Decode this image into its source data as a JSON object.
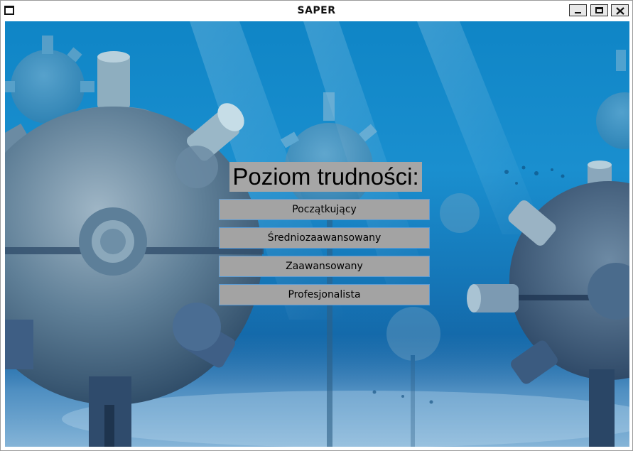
{
  "window": {
    "title": "SAPER",
    "controls": [
      "minimize-icon",
      "maximize-icon",
      "close-icon"
    ]
  },
  "menu": {
    "heading": "Poziom trudności:",
    "levels": [
      {
        "label": "Początkujący"
      },
      {
        "label": "Średniozaawansowany"
      },
      {
        "label": "Zaawansowany"
      },
      {
        "label": "Profesjonalista"
      }
    ]
  },
  "colors": {
    "water_top": "#0f85c6",
    "water_bottom": "#145f9f",
    "button_bg": "#a3a3a3",
    "button_border": "#5b9bd5",
    "heading_bg": "#a6a6a6"
  }
}
